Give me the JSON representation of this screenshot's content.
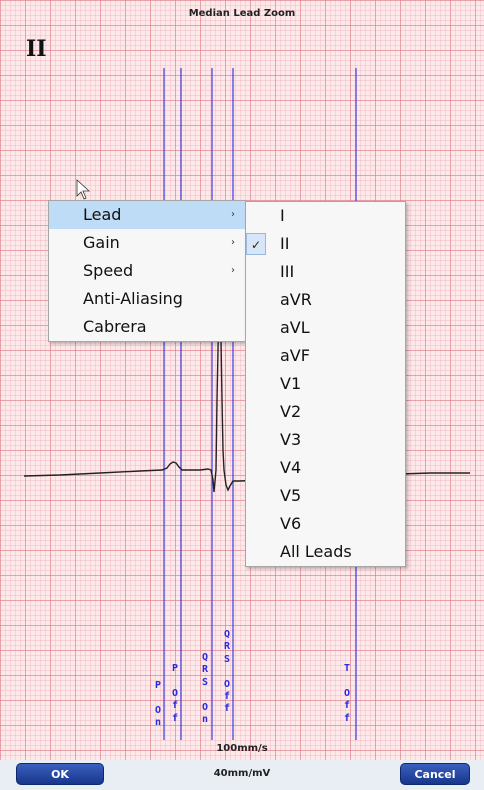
{
  "window": {
    "title": "Median Lead Zoom"
  },
  "lead_label": "II",
  "markers": [
    {
      "name": "p-on-marker",
      "text": "P On"
    },
    {
      "name": "p-off-marker",
      "text": "P Off"
    },
    {
      "name": "qrs-on-marker",
      "text": "QRS On"
    },
    {
      "name": "qrs-off-marker",
      "text": "QRS Off"
    },
    {
      "name": "t-off-marker",
      "text": "T Off"
    }
  ],
  "scale": {
    "speed": "100mm/s",
    "gain": "40mm/mV"
  },
  "buttons": {
    "ok": "OK",
    "cancel": "Cancel"
  },
  "context_menu": {
    "items": [
      {
        "label": "Lead",
        "submenu": true,
        "highlighted": true
      },
      {
        "label": "Gain",
        "submenu": true
      },
      {
        "label": "Speed",
        "submenu": true
      },
      {
        "label": "Anti-Aliasing",
        "submenu": false
      },
      {
        "label": "Cabrera",
        "submenu": false
      }
    ],
    "arrow_glyph": "›"
  },
  "lead_submenu": {
    "check_glyph": "✓",
    "selected": "II",
    "items": [
      "I",
      "II",
      "III",
      "aVR",
      "aVL",
      "aVF",
      "V1",
      "V2",
      "V3",
      "V4",
      "V5",
      "V6",
      "All Leads"
    ]
  },
  "colors": {
    "grid_bg": "#fde8ea",
    "marker": "#2b2bdd",
    "menu_highlight": "#bfdcf7",
    "button": "#1f3f97"
  }
}
